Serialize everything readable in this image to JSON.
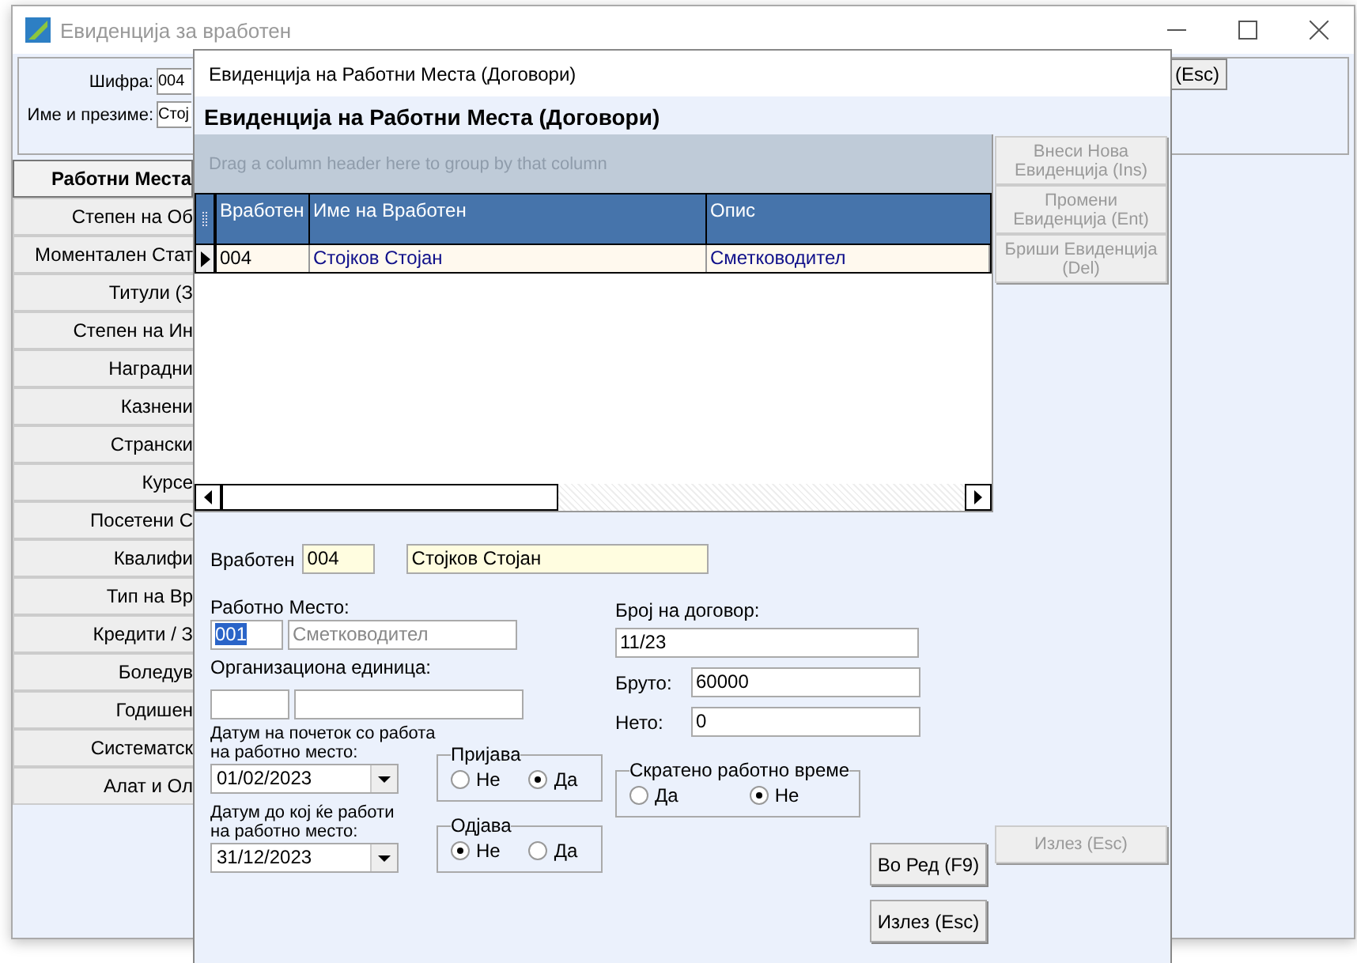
{
  "main_window": {
    "title": "Евиденција за вработен",
    "fields": [
      {
        "label": "Шифра:",
        "value": "004"
      },
      {
        "label": "Име и презиме:",
        "value": "Стој"
      }
    ],
    "exit_button": "(Esc)",
    "sidebar": {
      "items": [
        {
          "label": "Работни Места",
          "selected": true
        },
        {
          "label": "Степен на Об",
          "selected": false
        },
        {
          "label": "Моментален Стат",
          "selected": false
        },
        {
          "label": "Титули (З",
          "selected": false
        },
        {
          "label": "Степен на Ин",
          "selected": false
        },
        {
          "label": "Наградни",
          "selected": false
        },
        {
          "label": "Казнени",
          "selected": false
        },
        {
          "label": "Странски",
          "selected": false
        },
        {
          "label": "Курсе",
          "selected": false
        },
        {
          "label": "Посетени С",
          "selected": false
        },
        {
          "label": "Квалифи",
          "selected": false
        },
        {
          "label": "Тип на Вр",
          "selected": false
        },
        {
          "label": "Кредити / З",
          "selected": false
        },
        {
          "label": "Боледув",
          "selected": false
        },
        {
          "label": "Годишен",
          "selected": false
        },
        {
          "label": "Систематск",
          "selected": false
        },
        {
          "label": "Алат и Ол",
          "selected": false
        }
      ]
    }
  },
  "dialog": {
    "title": "Евиденција на Работни Места (Договори)",
    "heading": "Евиденција на Работни Места (Договори)",
    "grid": {
      "group_hint": "Drag a column header here to group by that column",
      "columns": [
        "Вработен",
        "Име на Вработен",
        "Опис"
      ],
      "rows": [
        {
          "selected": true,
          "cells": [
            "004",
            "Стојков Стојан",
            "Сметководител"
          ]
        }
      ]
    },
    "side_buttons": [
      {
        "label": "Внеси Нова Евиденција (Ins)",
        "disabled": true
      },
      {
        "label": "Промени Евиденција (Ent)",
        "disabled": true
      },
      {
        "label": "Бриши Евиденција (Del)",
        "disabled": true
      }
    ],
    "side_exit_button": {
      "label": "Излез (Esc)",
      "disabled": true
    },
    "form": {
      "employee": {
        "label": "Вработен",
        "code": "004",
        "name": "Стојков Стојан"
      },
      "workplace": {
        "label": "Работно Место:",
        "code": "001",
        "code_highlighted": true,
        "name": "Сметководител",
        "name_disabled": true
      },
      "org_unit": {
        "label": "Организациона единица:"
      },
      "start_date": {
        "label": "Датум на почеток со работа\nна работно место:",
        "value": "01/02/2023"
      },
      "end_date": {
        "label": "Датум до кој ќе работи\nна работно место:",
        "value": "31/12/2023"
      },
      "radio_groups": [
        {
          "title": "Пријава",
          "options": [
            {
              "label": "Не",
              "selected": false
            },
            {
              "label": "Да",
              "selected": true
            }
          ]
        },
        {
          "title": "Одјава",
          "options": [
            {
              "label": "Не",
              "selected": true
            },
            {
              "label": "Да",
              "selected": false
            }
          ]
        }
      ],
      "contract": {
        "label": "Број на договор:",
        "value": "11/23"
      },
      "gross": {
        "label": "Бруто:",
        "value": "60000"
      },
      "net": {
        "label": "Нето:",
        "value": "0"
      },
      "part_time": {
        "title": "Скратено работно време",
        "options": [
          {
            "label": "Да",
            "selected": false
          },
          {
            "label": "Не",
            "selected": true
          }
        ]
      },
      "buttons": [
        "Во Ред (F9)",
        "Излез (Esc)"
      ]
    }
  }
}
